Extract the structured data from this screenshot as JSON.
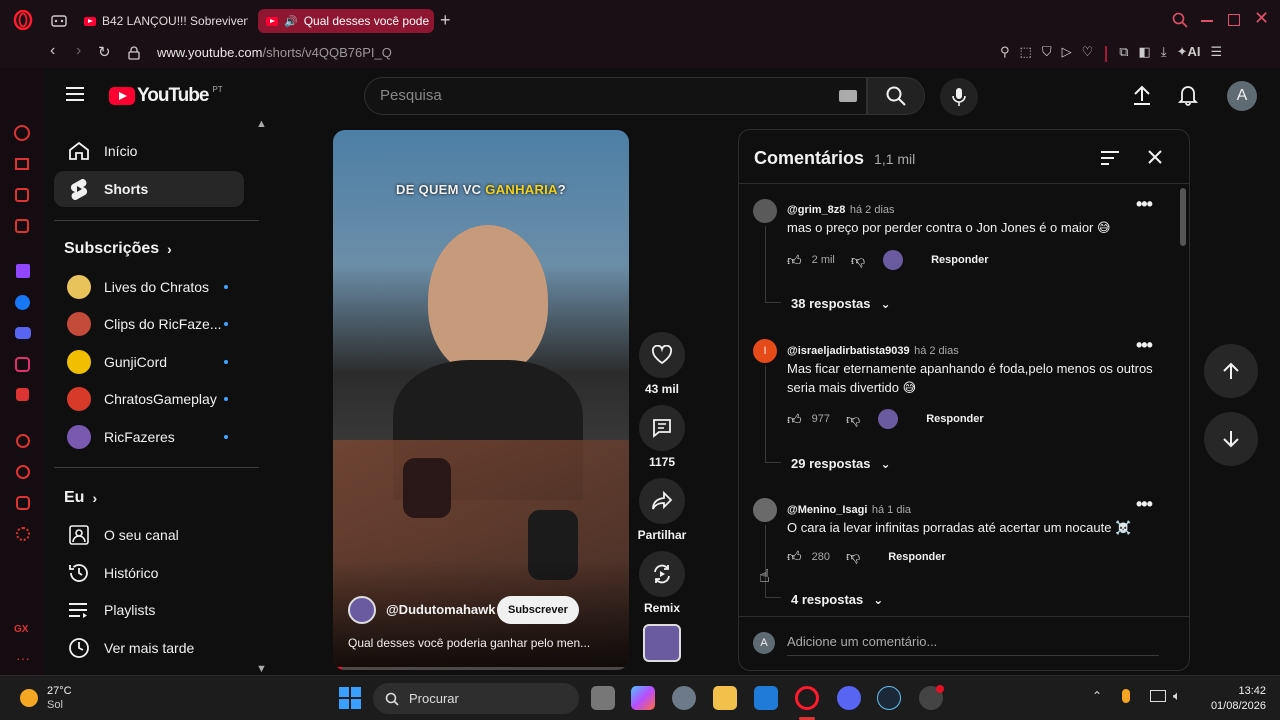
{
  "browser": {
    "tabs": [
      {
        "title": "B42 LANÇOU!!! Sobreviven",
        "active": false
      },
      {
        "title": "Qual desses você pode",
        "active": true
      }
    ],
    "url_domain": "www.youtube.com",
    "url_path": "/shorts/v4QQB76PI_Q"
  },
  "youtube": {
    "logo_text": "YouTube",
    "region": "PT",
    "search_placeholder": "Pesquisa",
    "avatar_letter": "A"
  },
  "sidebar": {
    "main": [
      {
        "label": "Início",
        "icon": "home-icon",
        "active": false
      },
      {
        "label": "Shorts",
        "icon": "shorts-icon",
        "active": true
      }
    ],
    "subscriptions_title": "Subscrições",
    "subscriptions": [
      {
        "label": "Lives do Chratos",
        "color": "#e8c25a"
      },
      {
        "label": "Clips do RicFaze...",
        "color": "#c44a3a"
      },
      {
        "label": "GunjiCord",
        "color": "#f0c000"
      },
      {
        "label": "ChratosGameplay",
        "color": "#d83a2a"
      },
      {
        "label": "RicFazeres",
        "color": "#7a5ab0"
      }
    ],
    "you_title": "Eu",
    "you_items": [
      {
        "label": "O seu canal",
        "icon": "channel-icon"
      },
      {
        "label": "Histórico",
        "icon": "history-icon"
      },
      {
        "label": "Playlists",
        "icon": "playlists-icon"
      },
      {
        "label": "Ver mais tarde",
        "icon": "watch-later-icon"
      }
    ]
  },
  "short": {
    "overlay_text_a": "DE QUEM VC ",
    "overlay_text_b": "GANHARIA",
    "overlay_text_c": "?",
    "channel": "@Dudutomahawk",
    "subscribe_label": "Subscrever",
    "title": "Qual desses você poderia ganhar pelo men...",
    "progress": 0.03
  },
  "actions": {
    "like_count": "43 mil",
    "comment_count": "1175",
    "share_label": "Partilhar",
    "remix_label": "Remix"
  },
  "comments": {
    "title": "Comentários",
    "count": "1,1 mil",
    "reply_label": "Responder",
    "add_placeholder": "Adicione um comentário...",
    "add_avatar": "A",
    "items": [
      {
        "user": "@grim_8z8",
        "time": "há 2 dias",
        "text": "mas o preço por perder contra o Jon Jones é o maior 😅",
        "likes": "2 mil",
        "replies": "38 respostas",
        "avatar_color": "#5a5a5a",
        "avatar_letter": ""
      },
      {
        "user": "@israeljadirbatista9039",
        "time": "há 2 dias",
        "text": "Mas ficar eternamente apanhando é foda,pelo menos os outros seria mais divertido 😅",
        "likes": "977",
        "replies": "29 respostas",
        "avatar_color": "#e64a19",
        "avatar_letter": "I"
      },
      {
        "user": "@Menino_Isagi",
        "time": "há 1 dia",
        "text": "O cara ia levar infinitas porradas até acertar um nocaute ☠️",
        "likes": "280",
        "replies": "4 respostas",
        "avatar_color": "#6a6a6a",
        "avatar_letter": ""
      }
    ]
  },
  "taskbar": {
    "weather_temp": "27°C",
    "weather_desc": "Sol",
    "search_label": "Procurar",
    "time": "13:42",
    "date": "01/08/2026"
  }
}
